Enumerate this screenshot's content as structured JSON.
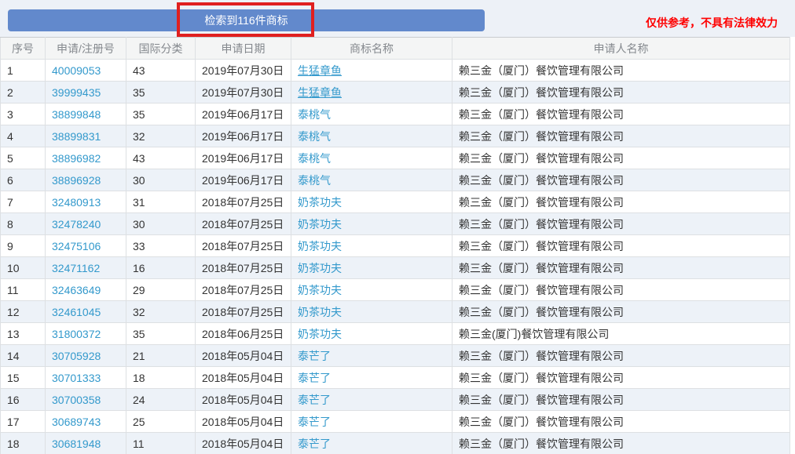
{
  "banner": {
    "label": "检索到116件商标"
  },
  "disclaimer": "仅供参考，不具有法律效力",
  "colors": {
    "banner_bg": "#6289cc",
    "link": "#3399cc",
    "alt_row_bg": "#edf2f8",
    "warning_text": "#fe0000",
    "highlight_border": "#e01f1f",
    "topbar_bg": "#edf1f7"
  },
  "table": {
    "headers": [
      "序号",
      "申请/注册号",
      "国际分类",
      "申请日期",
      "商标名称",
      "申请人名称"
    ],
    "rows": [
      {
        "no": "1",
        "reg": "40009053",
        "cls": "43",
        "date": "2019年07月30日",
        "name": "生猛章鱼",
        "applicant": "赖三金（厦门）餐饮管理有限公司",
        "underline": true
      },
      {
        "no": "2",
        "reg": "39999435",
        "cls": "35",
        "date": "2019年07月30日",
        "name": "生猛章鱼",
        "applicant": "赖三金（厦门）餐饮管理有限公司",
        "underline": true
      },
      {
        "no": "3",
        "reg": "38899848",
        "cls": "35",
        "date": "2019年06月17日",
        "name": "泰桃气",
        "applicant": "赖三金（厦门）餐饮管理有限公司",
        "underline": false
      },
      {
        "no": "4",
        "reg": "38899831",
        "cls": "32",
        "date": "2019年06月17日",
        "name": "泰桃气",
        "applicant": "赖三金（厦门）餐饮管理有限公司",
        "underline": false
      },
      {
        "no": "5",
        "reg": "38896982",
        "cls": "43",
        "date": "2019年06月17日",
        "name": "泰桃气",
        "applicant": "赖三金（厦门）餐饮管理有限公司",
        "underline": false
      },
      {
        "no": "6",
        "reg": "38896928",
        "cls": "30",
        "date": "2019年06月17日",
        "name": "泰桃气",
        "applicant": "赖三金（厦门）餐饮管理有限公司",
        "underline": false
      },
      {
        "no": "7",
        "reg": "32480913",
        "cls": "31",
        "date": "2018年07月25日",
        "name": "奶茶功夫",
        "applicant": "赖三金（厦门）餐饮管理有限公司",
        "underline": false
      },
      {
        "no": "8",
        "reg": "32478240",
        "cls": "30",
        "date": "2018年07月25日",
        "name": "奶茶功夫",
        "applicant": "赖三金（厦门）餐饮管理有限公司",
        "underline": false
      },
      {
        "no": "9",
        "reg": "32475106",
        "cls": "33",
        "date": "2018年07月25日",
        "name": "奶茶功夫",
        "applicant": "赖三金（厦门）餐饮管理有限公司",
        "underline": false
      },
      {
        "no": "10",
        "reg": "32471162",
        "cls": "16",
        "date": "2018年07月25日",
        "name": "奶茶功夫",
        "applicant": "赖三金（厦门）餐饮管理有限公司",
        "underline": false
      },
      {
        "no": "11",
        "reg": "32463649",
        "cls": "29",
        "date": "2018年07月25日",
        "name": "奶茶功夫",
        "applicant": "赖三金（厦门）餐饮管理有限公司",
        "underline": false
      },
      {
        "no": "12",
        "reg": "32461045",
        "cls": "32",
        "date": "2018年07月25日",
        "name": "奶茶功夫",
        "applicant": "赖三金（厦门）餐饮管理有限公司",
        "underline": false
      },
      {
        "no": "13",
        "reg": "31800372",
        "cls": "35",
        "date": "2018年06月25日",
        "name": "奶茶功夫",
        "applicant": "赖三金(厦门)餐饮管理有限公司",
        "underline": false
      },
      {
        "no": "14",
        "reg": "30705928",
        "cls": "21",
        "date": "2018年05月04日",
        "name": "泰芒了",
        "applicant": "赖三金（厦门）餐饮管理有限公司",
        "underline": false
      },
      {
        "no": "15",
        "reg": "30701333",
        "cls": "18",
        "date": "2018年05月04日",
        "name": "泰芒了",
        "applicant": "赖三金（厦门）餐饮管理有限公司",
        "underline": false
      },
      {
        "no": "16",
        "reg": "30700358",
        "cls": "24",
        "date": "2018年05月04日",
        "name": "泰芒了",
        "applicant": "赖三金（厦门）餐饮管理有限公司",
        "underline": false
      },
      {
        "no": "17",
        "reg": "30689743",
        "cls": "25",
        "date": "2018年05月04日",
        "name": "泰芒了",
        "applicant": "赖三金（厦门）餐饮管理有限公司",
        "underline": false
      },
      {
        "no": "18",
        "reg": "30681948",
        "cls": "11",
        "date": "2018年05月04日",
        "name": "泰芒了",
        "applicant": "赖三金（厦门）餐饮管理有限公司",
        "underline": false
      }
    ]
  }
}
